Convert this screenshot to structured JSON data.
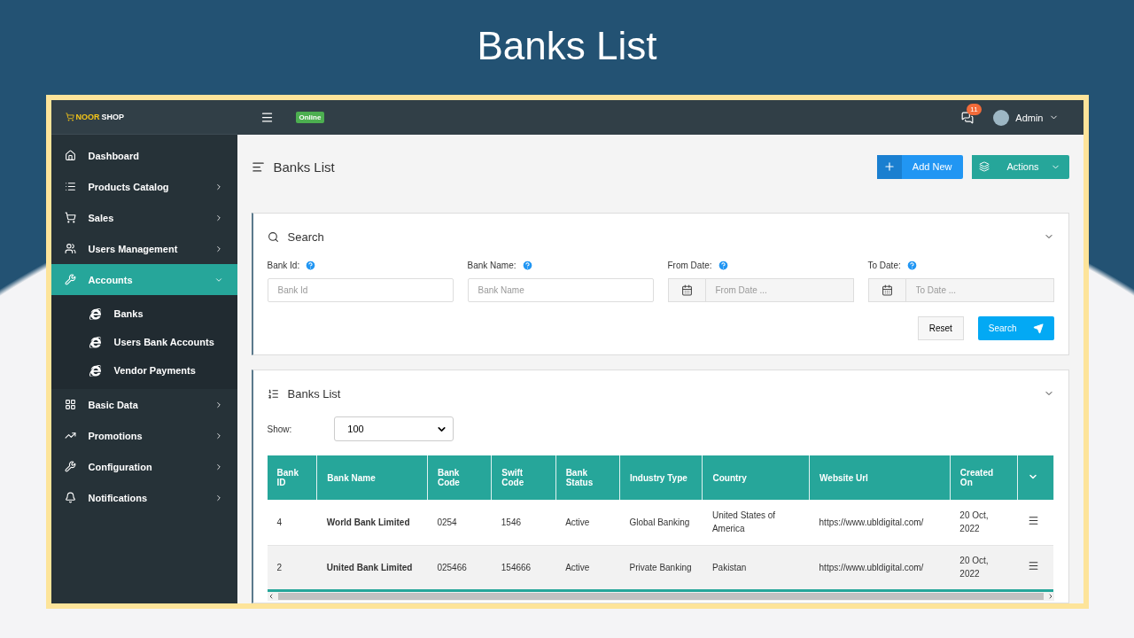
{
  "slide_title": "Banks List",
  "brand": {
    "first": "NOOR",
    "second": "SHOP"
  },
  "topbar": {
    "status": "Online",
    "notification_count": "11",
    "user": "Admin"
  },
  "sidebar": {
    "items": [
      {
        "label": "Dashboard",
        "kind": "link",
        "selected": false
      },
      {
        "label": "Products Catalog",
        "kind": "menu",
        "selected": false,
        "expanded": false
      },
      {
        "label": "Sales",
        "kind": "menu",
        "selected": false,
        "expanded": false
      },
      {
        "label": "Users Management",
        "kind": "menu",
        "selected": false,
        "expanded": false
      },
      {
        "label": "Accounts",
        "kind": "menu",
        "selected": true,
        "expanded": true,
        "children": [
          {
            "label": "Banks"
          },
          {
            "label": "Users Bank Accounts"
          },
          {
            "label": "Vendor Payments"
          }
        ]
      },
      {
        "label": "Basic Data",
        "kind": "menu",
        "selected": false,
        "expanded": false
      },
      {
        "label": "Promotions",
        "kind": "menu",
        "selected": false,
        "expanded": false
      },
      {
        "label": "Configuration",
        "kind": "menu",
        "selected": false,
        "expanded": false
      },
      {
        "label": "Notifications",
        "kind": "menu",
        "selected": false,
        "expanded": false
      }
    ]
  },
  "page_title": "Banks List",
  "header_buttons": {
    "add": "Add New",
    "actions": "Actions"
  },
  "search_panel": {
    "title": "Search",
    "fields": [
      {
        "label": "Bank Id:",
        "placeholder": "Bank Id",
        "kind": "text"
      },
      {
        "label": "Bank Name:",
        "placeholder": "Bank Name",
        "kind": "text"
      },
      {
        "label": "From Date:",
        "placeholder": "From Date ...",
        "kind": "date"
      },
      {
        "label": "To Date:",
        "placeholder": "To Date ...",
        "kind": "date"
      }
    ],
    "reset": "Reset",
    "search": "Search"
  },
  "list_panel": {
    "title": "Banks List",
    "show_label": "Show:",
    "show_value": "100",
    "columns": [
      "Bank ID",
      "Bank Name",
      "Bank Code",
      "Swift Code",
      "Bank Status",
      "Industry Type",
      "Country",
      "Website Url",
      "Created On"
    ],
    "rows": [
      [
        "4",
        "World Bank Limited",
        "0254",
        "1546",
        "Active",
        "Global Banking",
        "United States of America",
        "https://www.ubldigital.com/",
        "20 Oct, 2022"
      ],
      [
        "2",
        "United Bank Limited",
        "025466",
        "154666",
        "Active",
        "Private Banking",
        "Pakistan",
        "https://www.ubldigital.com/",
        "20 Oct, 2022"
      ]
    ]
  }
}
